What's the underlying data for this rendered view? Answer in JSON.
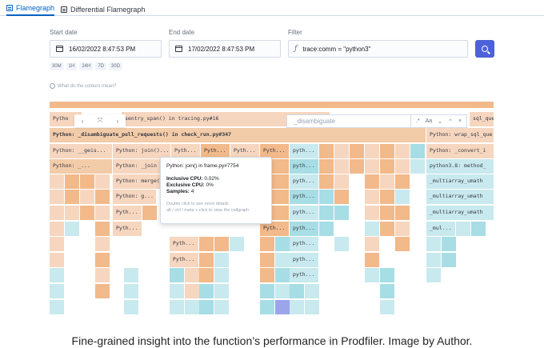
{
  "tabs": [
    {
      "label": "Flamegraph",
      "active": true
    },
    {
      "label": "Differential Flamegraph",
      "active": false
    }
  ],
  "fields": {
    "start": {
      "label": "Start date",
      "value": "16/02/2022 8:47:53 PM"
    },
    "end": {
      "label": "End date",
      "value": "17/02/2022 8:47:53 PM"
    },
    "filter": {
      "label": "Filter",
      "value": "trace:comm = \"python3\""
    }
  },
  "ranges": [
    "30M",
    "1H",
    "24H",
    "7D",
    "30D"
  ],
  "help_text": "What do the colours mean?",
  "toolbar": {
    "prev": "‹",
    "fit": "⤧",
    "next": "›"
  },
  "finder": {
    "placeholder": "_disambiguate",
    "regex": ".*",
    "case": "Aa",
    "down": "⌄",
    "up": "⌃",
    "close": "×"
  },
  "tooltip": {
    "title": "Python: join() in frame.py#7754",
    "inclusive_label": "Inclusive CPU:",
    "inclusive_value": "0.02%",
    "exclusive_label": "Exclusive CPU:",
    "exclusive_value": "0%",
    "samples_label": "Samples:",
    "samples_value": "4",
    "hint1": "Double click to see more details",
    "hint2": "alt / ctrl / meta + click to view the callgraph"
  },
  "flame_labels": {
    "r0_left": "Pytho",
    "r0_mid": "sentry_span() in tracing.py#16",
    "r0_right": "sql_que",
    "r1_left": "Python: _disambiguate_pull_requests() in check_run.py#347",
    "r1_right": "Python: wrap_sql_que",
    "r2a": "Python: __geis...",
    "r2b": "Python: join()...",
    "r2c": "Pyth...",
    "r2d": "Pyth...",
    "r2e": "Pyth...",
    "r2f": "Pyth...",
    "r2g": "pyth...",
    "r2h": "Python: _convert_i",
    "r3a": "Python: _...",
    "r3b": "Python: _join",
    "r3c": "pyth...",
    "r3d": "python3.8: method_",
    "r4a": "Python: merge(",
    "r4b": "pyth...",
    "r4c": "_multiarray_umath",
    "r5a": "Python: g...",
    "r5b": "pyth...",
    "r5c": "_multiarray_umath",
    "r6a": "Pyth...",
    "r6b": "pyth...",
    "r6c": "_multiarray_umath",
    "r7a": "Pyth...",
    "r7b": "Pyth...",
    "r7c": "pyth...",
    "r7d": "_mul...",
    "r8a": "Pyth...",
    "r8b": "pyth...",
    "r9a": "Pyth...",
    "r9b": "pyth...",
    "r10a": "pyth..."
  },
  "colors": {
    "accent": "#0061c2",
    "button": "#4d61d8",
    "orange": "#f2b98a",
    "teal": "#a7dde5",
    "peach": "#f6d6bf",
    "selected": "#9aa5ea"
  },
  "caption": "Fine-grained insight into the function’s performance in Prodfiler. Image by Author."
}
